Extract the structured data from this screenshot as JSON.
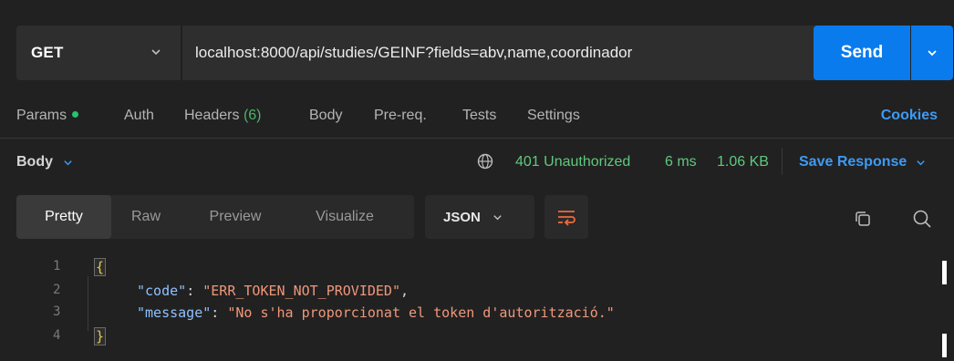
{
  "request": {
    "method": "GET",
    "url": "localhost:8000/api/studies/GEINF?fields=abv,name,coordinador",
    "send_label": "Send"
  },
  "request_tabs": {
    "params": "Params",
    "auth": "Auth",
    "headers": "Headers",
    "headers_count": "(6)",
    "body": "Body",
    "prereq": "Pre-req.",
    "tests": "Tests",
    "settings": "Settings",
    "cookies": "Cookies"
  },
  "response": {
    "body_label": "Body",
    "status": "401 Unauthorized",
    "time": "6 ms",
    "size": "1.06 KB",
    "save_label": "Save Response"
  },
  "view_tabs": [
    "Pretty",
    "Raw",
    "Preview",
    "Visualize"
  ],
  "format": "JSON",
  "code": {
    "line_numbers": [
      "1",
      "2",
      "3",
      "4"
    ],
    "open_brace": "{",
    "close_brace": "}",
    "key1": "\"code\"",
    "val1": "\"ERR_TOKEN_NOT_PROVIDED\"",
    "key2": "\"message\"",
    "val2": "\"No s'ha proporcionat el token d'autorització.\""
  },
  "colors": {
    "accent": "#097bed",
    "status_ok_text": "#5fc97d",
    "link": "#3d9bf5"
  }
}
